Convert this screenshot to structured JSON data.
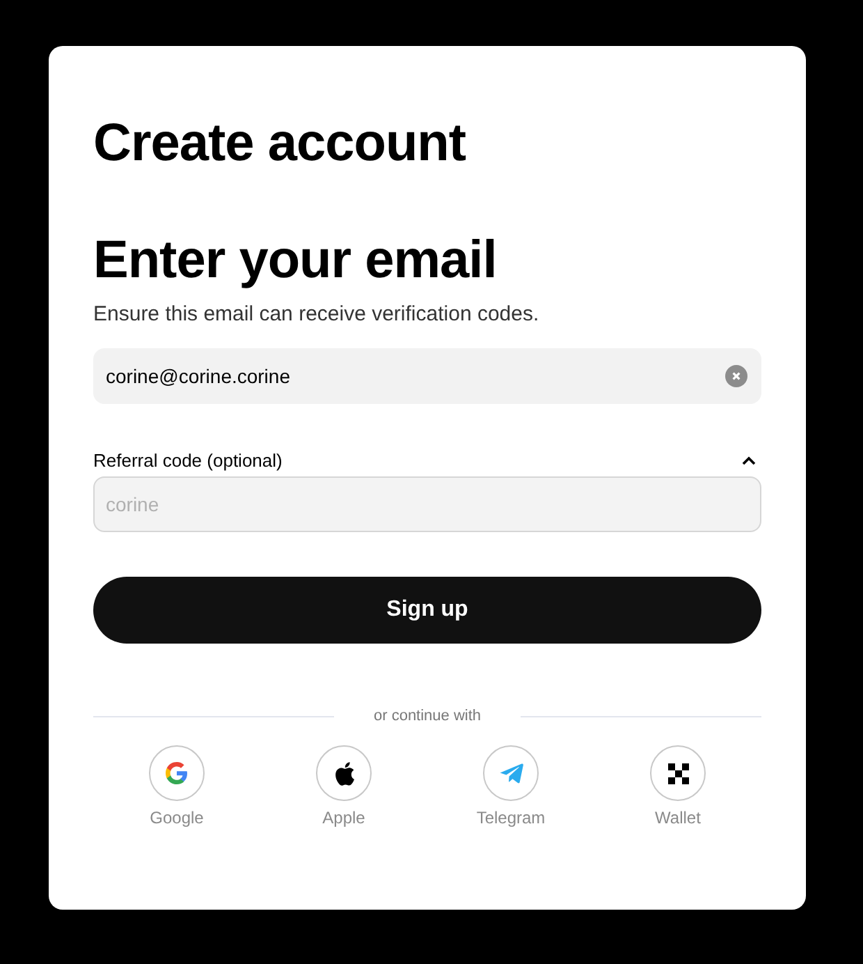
{
  "title": "Create account",
  "heading": "Enter your email",
  "subtitle": "Ensure this email can receive verification codes.",
  "email": {
    "value": "corine@corine.corine"
  },
  "referral": {
    "label": "Referral code (optional)",
    "expanded": true,
    "placeholder": "corine"
  },
  "submit": "Sign up",
  "divider": "or continue with",
  "providers": [
    {
      "kind": "google",
      "label": "Google"
    },
    {
      "kind": "apple",
      "label": "Apple"
    },
    {
      "kind": "telegram",
      "label": "Telegram"
    },
    {
      "kind": "wallet",
      "label": "Wallet"
    }
  ]
}
